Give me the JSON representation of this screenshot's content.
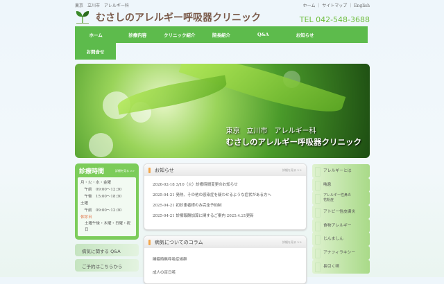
{
  "header": {
    "breadcrumb": "東京　立川市　アレルギー科",
    "util_links": [
      "ホーム",
      "サイトマップ",
      "English"
    ],
    "title": "むさしのアレルギー呼吸器クリニック",
    "tel": "TEL  042-548-3688"
  },
  "nav": [
    "ホーム",
    "診療内容",
    "クリニック紹介",
    "院長紹介",
    "Q&A",
    "お知らせ",
    "お問合せ"
  ],
  "hero": {
    "line1": "東京　立川市　アレルギー科",
    "line2": "むさしのアレルギー呼吸器クリニック"
  },
  "hours": {
    "title": "診療時間",
    "more": "詳細を見る >>",
    "lines": [
      "月・火・水・金曜",
      "　午前　09:00〜12:30",
      "　午後　15:00〜18:30",
      "土曜",
      "　午前　09:00〜12:30"
    ],
    "closed_label": "休診日",
    "closed": "土曜午後・木曜・日曜・祝日"
  },
  "side_buttons": [
    "病気に関する Q&A",
    "ご予約はこちらから"
  ],
  "news": {
    "title": "お知らせ",
    "more": "詳細を見る >>",
    "items": [
      "2026-02-18 3/10（火）診療時間変更のお知らせ",
      "2025-04-21 発熱、その他の感染症を疑わせるような症状がある方へ",
      "2025-04-21 初診患者様のみ完全予約制",
      "2025-04-21 診療報酬加算に関するご案内 2025.4.21更新"
    ]
  },
  "column": {
    "title": "病気についてのコラム",
    "more": "詳細を見る >>",
    "items": [
      "睡眠時無呼吸症候群",
      "成人の百日咳"
    ]
  },
  "right_menu": [
    "アレルギーとは",
    "喘息",
    "アレルギー性鼻炎\n花粉症",
    "アトピー性皮膚炎",
    "食物アレルギー",
    "じんましん",
    "アナフィラキシー",
    "長引く咳"
  ]
}
